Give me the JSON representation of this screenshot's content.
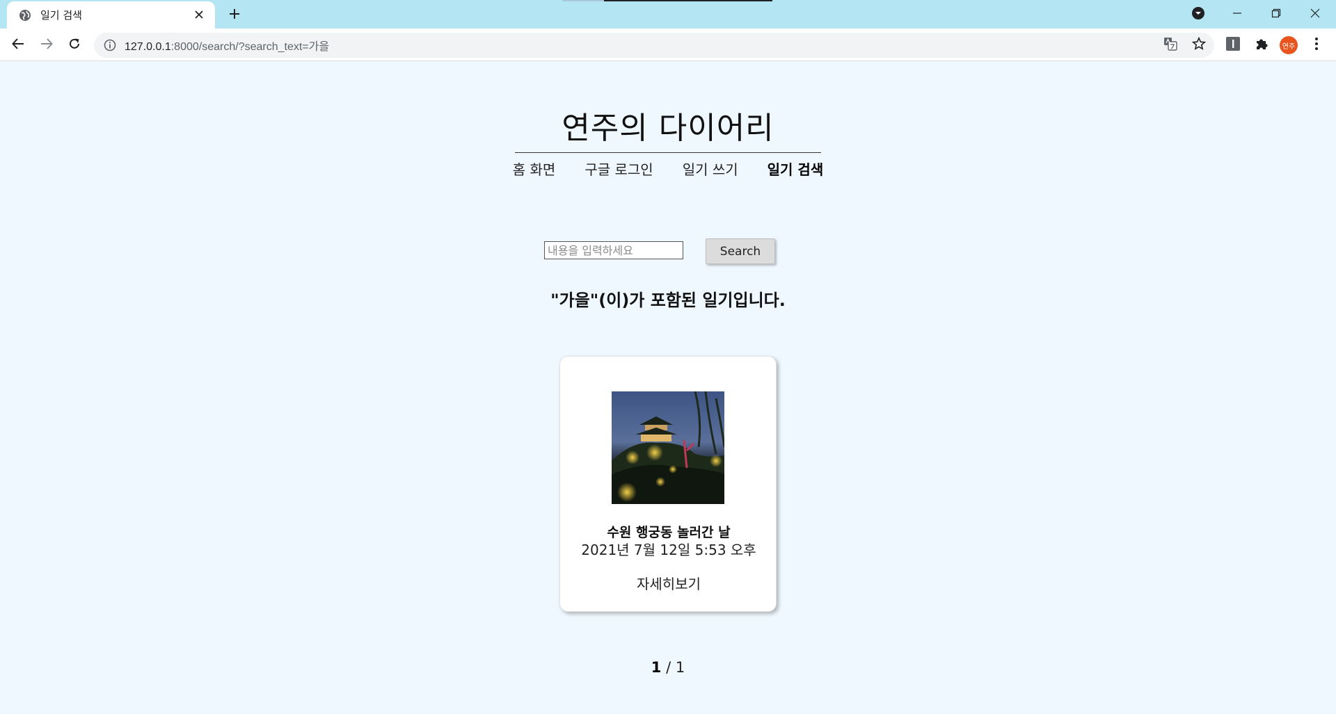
{
  "browser": {
    "tab_title": "일기 검색",
    "url_host": "127.0.0.1",
    "url_rest": ":8000/search/?search_text=가을",
    "profile_label": "연주",
    "icons": {
      "tab_favicon": "globe-icon",
      "tab_close": "close-icon",
      "new_tab": "plus-icon",
      "back": "arrow-left-icon",
      "forward": "arrow-right-icon",
      "reload": "reload-icon",
      "site_info": "info-icon",
      "translate": "translate-icon",
      "bookmark": "star-icon",
      "extension_reader": "extension-icon",
      "extensions": "puzzle-icon",
      "menu": "kebab-menu-icon",
      "tab_search": "tab-search-icon",
      "minimize": "minimize-icon",
      "restore": "restore-icon",
      "close_window": "close-icon"
    },
    "colors": {
      "tabbar": "#b3e5f2",
      "avatar": "#e8541d"
    }
  },
  "page": {
    "site_title": "연주의 다이어리",
    "nav": [
      {
        "label": "홈 화면",
        "active": false
      },
      {
        "label": "구글 로그인",
        "active": false
      },
      {
        "label": "일기 쓰기",
        "active": false
      },
      {
        "label": "일기 검색",
        "active": true
      }
    ],
    "search": {
      "placeholder": "내용을 입력하세요",
      "value": "",
      "button_label": "Search"
    },
    "result_heading": "\"가을\"(이)가 포함된 일기입니다.",
    "results": [
      {
        "title": "수원 행궁동 놀러간 날",
        "date": "2021년 7월 12일 5:53 오후",
        "link_label": "자세히보기",
        "image": "night-pavilion-photo"
      }
    ],
    "pagination": {
      "current": "1",
      "separator": "/",
      "total": "1"
    },
    "colors": {
      "background": "#f0f8ff"
    }
  }
}
